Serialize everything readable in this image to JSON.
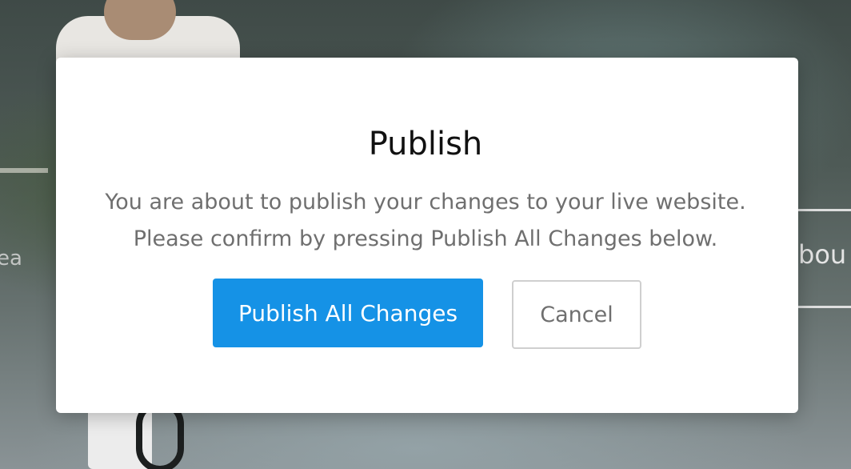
{
  "background": {
    "nav_item_text": "bou",
    "left_partial_text": "ea"
  },
  "dialog": {
    "title": "Publish",
    "message_line1": "You are about to publish your changes to your live website.",
    "message_line2": "Please confirm by pressing Publish All Changes below.",
    "primary_button_label": "Publish All Changes",
    "secondary_button_label": "Cancel"
  },
  "colors": {
    "primary": "#1592e6",
    "text_muted": "#6f6f6f",
    "dialog_bg": "#ffffff"
  }
}
